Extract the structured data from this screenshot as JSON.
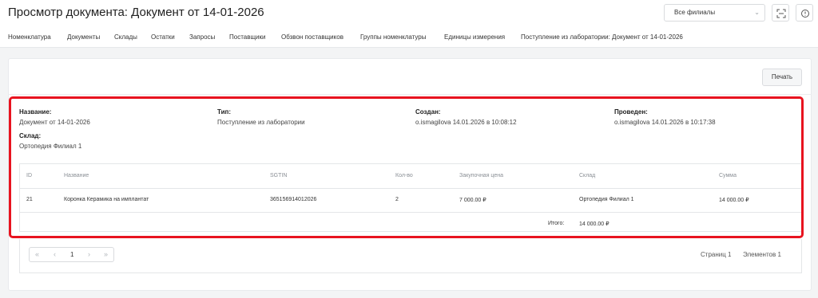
{
  "header": {
    "title": "Просмотр документа: Документ от 14-01-2026",
    "branch_select": "Все филиалы",
    "icons": [
      "scan-icon",
      "info-icon"
    ]
  },
  "nav": {
    "items": [
      "Номенклатура",
      "Документы",
      "Склады",
      "Остатки",
      "Запросы",
      "Поставщики",
      "Обзвон поставщиков",
      "Группы номенклатуры",
      "Единицы измерения",
      "Поступление из лаборатории: Документ от 14-01-2026"
    ]
  },
  "toolbar": {
    "print_label": "Печать"
  },
  "document": {
    "name_label": "Название:",
    "name_value": "Документ от 14-01-2026",
    "type_label": "Тип:",
    "type_value": "Поступление из лаборатории",
    "created_label": "Создан:",
    "created_value": "o.ismagilova 14.01.2026 в 10:08:12",
    "posted_label": "Проведен:",
    "posted_value": "o.ismagilova 14.01.2026 в 10:17:38",
    "warehouse_label": "Склад:",
    "warehouse_value": "Ортопедия Филиал 1"
  },
  "table": {
    "headers": [
      "ID",
      "Название",
      "SGTIN",
      "Кол-во",
      "Закупочная цена",
      "Склад",
      "Сумма"
    ],
    "rows": [
      [
        "21",
        "Коронка Керамика на имплантат",
        "365156914012026",
        "2",
        "7 000.00 ₽",
        "Ортопедия Филиал 1",
        "14 000.00 ₽"
      ]
    ],
    "total_label": "Итого:",
    "total_value": "14 000.00 ₽"
  },
  "pagination": {
    "first": "«",
    "prev": "‹",
    "current": "1",
    "next": "›",
    "last": "»",
    "pages_text": "Страниц 1",
    "items_text": "Элементов 1"
  },
  "colors": {
    "highlight": "#e8131f",
    "background": "#f3f4f5"
  }
}
